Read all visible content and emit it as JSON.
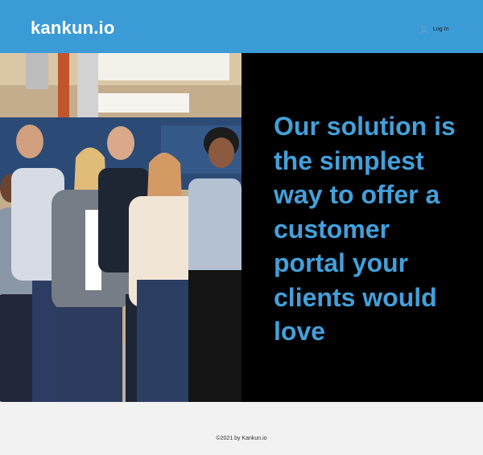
{
  "header": {
    "logo": "kankun.io",
    "login_label": "Log In",
    "login_icon": "user-icon"
  },
  "hero": {
    "photo": "team-photo",
    "headline": "Our solution is the simplest way to offer a customer portal your clients would love"
  },
  "footer": {
    "copyright": "©2021 by Kankun.io"
  },
  "colors": {
    "header_bg": "#3b9bd6",
    "headline": "#43a0da",
    "panel_bg": "#000000",
    "footer_bg": "#f2f2f2"
  }
}
